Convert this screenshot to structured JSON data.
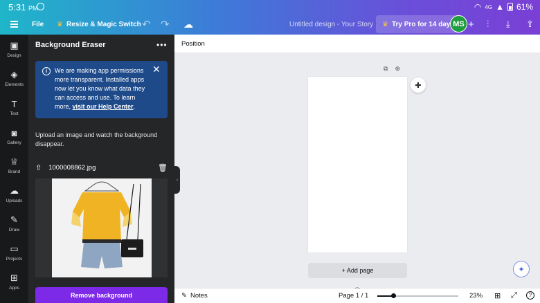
{
  "status_bar": {
    "time": "5:31",
    "ampm": "PM",
    "signal": "4G",
    "battery": "61%"
  },
  "toolbar": {
    "file_label": "File",
    "resize_label": "Resize & Magic Switch",
    "doc_title": "Untitled design - Your Story",
    "pro_label": "Try Pro for 14 days",
    "avatar_initials": "MS"
  },
  "rail": {
    "items": [
      {
        "label": "Design",
        "icon": "layout-icon"
      },
      {
        "label": "Elements",
        "icon": "shapes-icon"
      },
      {
        "label": "Text",
        "icon": "text-icon"
      },
      {
        "label": "Gallery",
        "icon": "camera-icon"
      },
      {
        "label": "Brand",
        "icon": "brand-icon"
      },
      {
        "label": "Uploads",
        "icon": "upload-icon"
      },
      {
        "label": "Draw",
        "icon": "pen-icon"
      },
      {
        "label": "Projects",
        "icon": "folder-icon"
      },
      {
        "label": "Apps",
        "icon": "apps-icon"
      }
    ]
  },
  "panel": {
    "title": "Background Eraser",
    "notice_text": "We are making app permissions more transparent. Installed apps now let you know what data they can access and use. To learn more,",
    "notice_link": "visit our Help Center",
    "notice_end": ".",
    "description": "Upload an image and watch the background disappear.",
    "file_name": "1000008862.jpg",
    "remove_label": "Remove background"
  },
  "canvas": {
    "position_label": "Position",
    "add_page_label": "+ Add page"
  },
  "footer": {
    "notes_label": "Notes",
    "page_label": "Page 1 / 1",
    "zoom_label": "23%",
    "zoom_fraction": 0.2
  },
  "colors": {
    "accent": "#7d2ae8",
    "panel": "#252627",
    "rail": "#18191b",
    "notice": "#1e4a8a",
    "avatar": "#1e9e3e"
  }
}
